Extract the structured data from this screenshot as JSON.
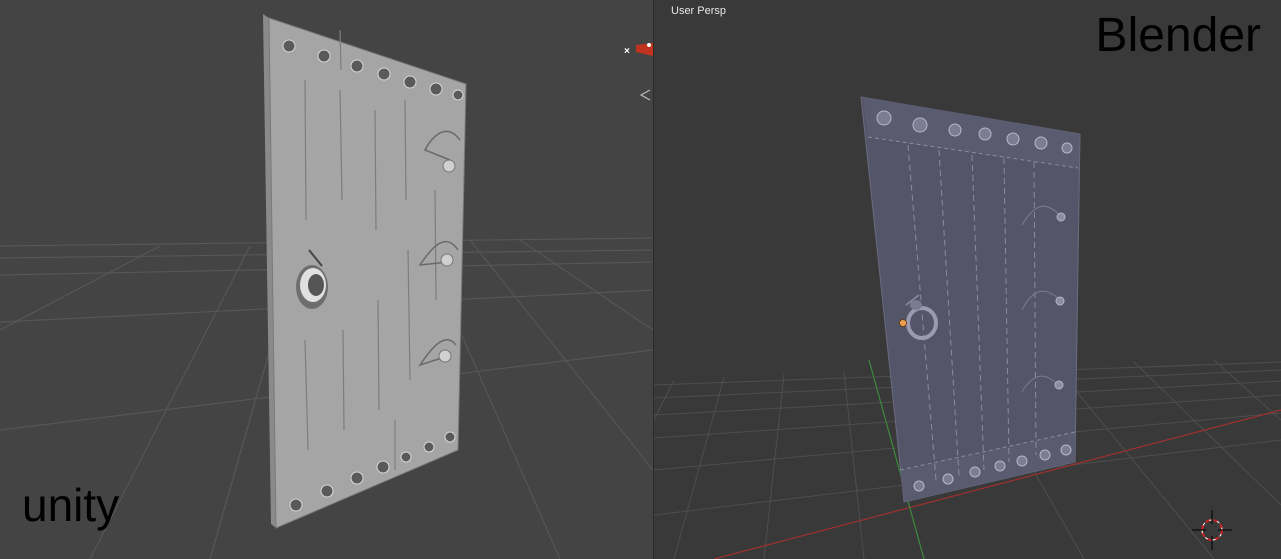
{
  "unity": {
    "caption": "unity",
    "icons": [
      "gizmo-axis-icon",
      "back-arrow-icon"
    ]
  },
  "blender": {
    "caption": "Blender",
    "view_label": "User Persp",
    "icons": [
      "3d-cursor-icon",
      "origin-dot-icon"
    ],
    "axis_colors": {
      "x": "#a03030",
      "y": "#3c8a3c"
    }
  },
  "colors": {
    "unity_bg": "#444444",
    "blender_bg": "#393939",
    "unity_door": "#a5a5a5",
    "blender_door": "#55556a"
  }
}
